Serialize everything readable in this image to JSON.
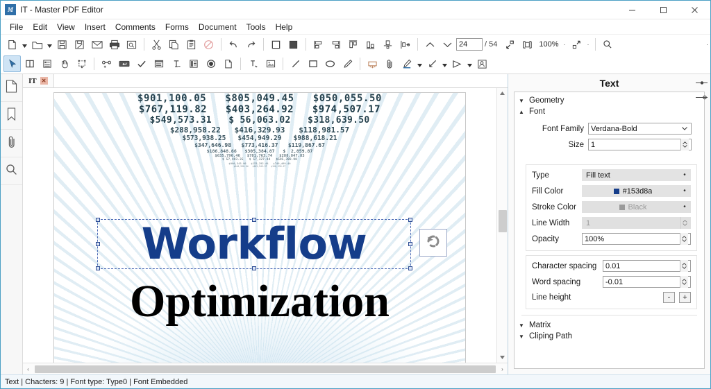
{
  "window": {
    "title": "IT - Master PDF Editor",
    "app_icon": "master-pdf-editor-icon",
    "minimize": "–",
    "maximize": "☐",
    "close": "✕"
  },
  "menubar": {
    "items": [
      {
        "label": "File"
      },
      {
        "label": "Edit"
      },
      {
        "label": "View"
      },
      {
        "label": "Insert"
      },
      {
        "label": "Comments"
      },
      {
        "label": "Forms"
      },
      {
        "label": "Document"
      },
      {
        "label": "Tools"
      },
      {
        "label": "Help"
      }
    ]
  },
  "toolbar_row1": {
    "buttons": [
      {
        "name": "new-document-button",
        "icon": "new-page-icon"
      },
      {
        "name": "new-document-dropdown",
        "icon": "chevron-down-icon"
      },
      {
        "name": "open-document-button",
        "icon": "folder-open-icon"
      },
      {
        "name": "open-document-dropdown",
        "icon": "chevron-down-icon"
      },
      {
        "name": "save-button",
        "icon": "save-icon"
      },
      {
        "name": "save-as-button",
        "icon": "save-as-icon"
      },
      {
        "name": "email-button",
        "icon": "envelope-icon"
      },
      {
        "name": "print-button",
        "icon": "printer-icon"
      },
      {
        "name": "print-preview-button",
        "icon": "print-preview-icon"
      },
      {
        "name": "cut-button",
        "icon": "scissors-icon"
      },
      {
        "name": "copy-button",
        "icon": "copy-icon"
      },
      {
        "name": "paste-button",
        "icon": "clipboard-icon"
      },
      {
        "name": "delete-button",
        "icon": "no-entry-icon"
      },
      {
        "name": "undo-button",
        "icon": "undo-arrow-icon"
      },
      {
        "name": "redo-button",
        "icon": "redo-arrow-icon"
      },
      {
        "name": "fill-none-button",
        "icon": "square-outline-icon"
      },
      {
        "name": "fill-solid-button",
        "icon": "square-filled-icon"
      },
      {
        "name": "align-left-button",
        "icon": "align-left-icon"
      },
      {
        "name": "align-right-button",
        "icon": "align-right-icon"
      },
      {
        "name": "align-top-button",
        "icon": "align-top-icon"
      },
      {
        "name": "align-bottom-button",
        "icon": "align-bottom-icon"
      },
      {
        "name": "center-horizontal-button",
        "icon": "center-horizontal-icon"
      },
      {
        "name": "distribute-button",
        "icon": "distribute-icon"
      },
      {
        "name": "previous-page-button",
        "icon": "chevron-up-icon"
      },
      {
        "name": "next-page-button",
        "icon": "chevron-down-icon"
      }
    ],
    "page_current": "24",
    "page_total": "/ 54",
    "fit_page_button": "fit-page-icon",
    "fit_width_button": "fit-width-icon",
    "zoom_level": "100%",
    "zoom_dropdown_dot": "·",
    "zoom_selection_button": "zoom-selection-icon",
    "zoom_selection_dropdown": "·",
    "search_icon": "search-icon",
    "search_placeholder": "",
    "search_value": "",
    "overflow_dot": "·"
  },
  "toolbar_row2": {
    "buttons": [
      {
        "name": "select-tool-button",
        "icon": "arrow-cursor-icon",
        "active": true
      },
      {
        "name": "split-view-button",
        "icon": "split-columns-icon"
      },
      {
        "name": "form-fields-button",
        "icon": "form-list-icon"
      },
      {
        "name": "hand-tool-button",
        "icon": "hand-icon"
      },
      {
        "name": "crop-tool-button",
        "icon": "crop-icon"
      },
      {
        "name": "link-tool-button",
        "icon": "add-link-icon"
      },
      {
        "name": "text-field-button",
        "icon": "text-field-icon"
      },
      {
        "name": "checkbox-field-button",
        "icon": "check-icon"
      },
      {
        "name": "combo-box-button",
        "icon": "combo-box-icon"
      },
      {
        "name": "text-insert-button",
        "icon": "text-insert-icon"
      },
      {
        "name": "list-box-button",
        "icon": "list-box-icon"
      },
      {
        "name": "radio-button-button",
        "icon": "radio-filled-icon"
      },
      {
        "name": "page-object-button",
        "icon": "page-object-icon"
      },
      {
        "name": "edit-text-button",
        "icon": "edit-text-icon"
      },
      {
        "name": "insert-image-button",
        "icon": "image-icon"
      },
      {
        "name": "line-tool-button",
        "icon": "line-icon"
      },
      {
        "name": "rectangle-tool-button",
        "icon": "rectangle-icon"
      },
      {
        "name": "ellipse-tool-button",
        "icon": "ellipse-icon"
      },
      {
        "name": "pencil-tool-button",
        "icon": "pencil-icon"
      },
      {
        "name": "stamp-tool-button",
        "icon": "stamp-icon"
      },
      {
        "name": "attach-file-button",
        "icon": "paperclip-icon"
      },
      {
        "name": "highlight-tool-button",
        "icon": "highlighter-icon"
      },
      {
        "name": "highlight-dropdown",
        "icon": "chevron-down-icon"
      },
      {
        "name": "arrow-annotation-button",
        "icon": "arrow-annotation-icon"
      },
      {
        "name": "arrow-dropdown",
        "icon": "chevron-down-icon"
      },
      {
        "name": "measure-tool-button",
        "icon": "measure-angle-icon"
      },
      {
        "name": "measure-dropdown",
        "icon": "chevron-down-icon"
      },
      {
        "name": "signature-button",
        "icon": "signature-stamp-icon"
      }
    ]
  },
  "left_rail": {
    "items": [
      {
        "name": "sidebar-pages",
        "icon": "page-thumbnail-icon"
      },
      {
        "name": "sidebar-bookmarks",
        "icon": "bookmark-icon"
      },
      {
        "name": "sidebar-attachments",
        "icon": "paperclip-icon"
      },
      {
        "name": "sidebar-search",
        "icon": "search-icon"
      }
    ]
  },
  "document_tab": {
    "label": "IT",
    "close_glyph": "✕"
  },
  "document": {
    "number_rows": [
      {
        "text": "$901,100.05   $805,049.45   $050,055.50",
        "size": 14,
        "opacity": 0.92,
        "spread": 1
      },
      {
        "text": "$767,119.82   $403,264.92   $974,507.17",
        "size": 14,
        "opacity": 0.95,
        "spread": 1
      },
      {
        "text": "$549,573.31   $ 56,063.02   $318,639.50",
        "size": 13,
        "opacity": 0.93,
        "spread": 1
      },
      {
        "text": "$288,958.22   $416,329.93   $118,981.57",
        "size": 11,
        "opacity": 0.9,
        "spread": 1
      },
      {
        "text": "$573,938.25   $454,949.29   $988,618.21",
        "size": 9.5,
        "opacity": 0.85,
        "spread": 1
      },
      {
        "text": "$347,646.98   $773,416.37   $119,867.67",
        "size": 8,
        "opacity": 0.8,
        "spread": 1
      },
      {
        "text": "$186,848.66   $305,384.87   $  2,859.87",
        "size": 6.5,
        "opacity": 0.72,
        "spread": 1
      },
      {
        "text": "$635,796.46   $781,763.74   $288,847.83",
        "size": 5.5,
        "opacity": 0.65,
        "spread": 1
      },
      {
        "text": "$ 57,493.35   $ 57,327.44   $595,398.90",
        "size": 4.6,
        "opacity": 0.58,
        "spread": 1
      },
      {
        "text": "$996,343.90   $153,292.44   $749,469.40",
        "size": 3.8,
        "opacity": 0.5,
        "spread": 1
      },
      {
        "text": "$946,336.94   $963,543.37   $196,339.27",
        "size": 3.2,
        "opacity": 0.42,
        "spread": 1
      }
    ],
    "headline_primary": "Workflow",
    "headline_primary_color": "#153d8a",
    "headline_secondary": "Optimization",
    "headline_secondary_color": "#000000",
    "rotate_handle_icon": "rotate-icon"
  },
  "scrollbars": {
    "vertical": {
      "up": "▲",
      "down": "▼"
    },
    "horizontal": {
      "left": "‹",
      "right": "›"
    }
  },
  "properties_panel": {
    "title": "Text",
    "header_tools": [
      {
        "name": "panel-pin-icon",
        "icon": "pin-slider-icon"
      },
      {
        "name": "panel-options-icon",
        "icon": "options-slider-icon"
      }
    ],
    "sections": {
      "geometry": {
        "label": "Geometry",
        "expanded": false,
        "tri": "▼"
      },
      "font": {
        "label": "Font",
        "expanded": true,
        "tri": "▲"
      },
      "matrix": {
        "label": "Matrix",
        "expanded": false,
        "tri": "▼"
      },
      "clipping_path": {
        "label": "Cliping Path",
        "expanded": false,
        "tri": "▼"
      }
    },
    "font": {
      "font_family_label": "Font Family",
      "font_family_value": "Verdana-Bold",
      "size_label": "Size",
      "size_value": "1",
      "type_label": "Type",
      "type_value": "Fill text",
      "fill_color_label": "Fill Color",
      "fill_color_value": "#153d8a",
      "fill_color_swatch": "#153d8a",
      "stroke_color_label": "Stroke Color",
      "stroke_color_value": "Black",
      "stroke_color_swatch": "#9a9a9a",
      "line_width_label": "Line Width",
      "line_width_value": "1",
      "opacity_label": "Opacity",
      "opacity_value": "100%",
      "character_spacing_label": "Character spacing",
      "character_spacing_value": "0.01",
      "word_spacing_label": "Word spacing",
      "word_spacing_value": "-0.01",
      "line_height_label": "Line height",
      "line_height_minus": "-",
      "line_height_plus": "+"
    }
  },
  "statusbar": {
    "text": "Text | Chacters: 9 | Font type: Type0 | Font Embedded"
  }
}
